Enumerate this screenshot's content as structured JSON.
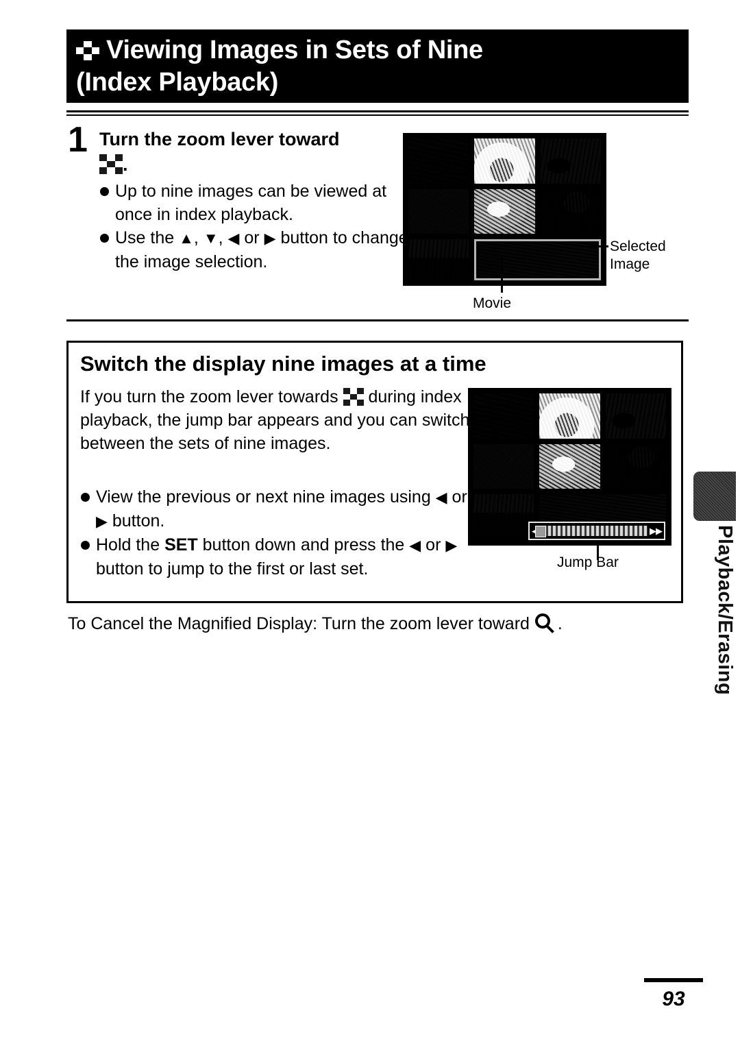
{
  "header": {
    "icon": "index-checkerboard-icon",
    "title_line1": "Viewing Images in Sets of Nine",
    "title_line2": "(Index Playback)"
  },
  "step1": {
    "number": "1",
    "heading_line1": "Turn the zoom lever toward",
    "heading_line2_icon": "index-checkerboard-icon",
    "heading_line2_suffix": ".",
    "bullets": [
      {
        "icon": "bullet-dot",
        "text": "Up to nine images can be viewed at once in index playback."
      },
      {
        "icon": "bullet-dot",
        "text_before": "Use the",
        "arrow_up": "▲",
        "sep1": ",",
        "arrow_down": "▼",
        "sep2": ",",
        "arrow_left": "◀",
        "or": "or",
        "arrow_right": "▶",
        "text_after": "button to change the image selection."
      }
    ],
    "screen": {
      "callout_selected": "Selected",
      "callout_selected_line2": "Image",
      "callout_movie": "Movie"
    }
  },
  "section": {
    "title": "Switch the display nine images at a time",
    "paragraph_part1": "If you turn the zoom lever towards",
    "paragraph_icon": "index-checkerboard-icon",
    "paragraph_part2": "during index playback, the jump bar appears and you can switch between the sets of nine images.",
    "bullets": [
      {
        "icon": "bullet-dot",
        "line1": "View the previous or next nine images",
        "line2_prefix": "using",
        "arrow_left": "◀",
        "or": "or",
        "arrow_right": "▶",
        "line2_suffix": "button."
      },
      {
        "icon": "bullet-dot",
        "line1_prefix": "Hold the",
        "set_label": "SET",
        "line1_suffix": "button down and press",
        "line2_prefix": "the",
        "arrow_left": "◀",
        "or": "or",
        "arrow_right": "▶",
        "line2_suffix": "button to jump to the first or last set."
      }
    ],
    "screen": {
      "jump_bar_left_arrow": "◀◀",
      "jump_bar_right_arrow": "▶▶",
      "callout_jump_bar": "Jump Bar"
    }
  },
  "cancel_note": {
    "text": "To Cancel the Magnified Display: Turn the zoom lever toward",
    "icon": "magnifier-icon",
    "suffix": "."
  },
  "side_tab": {
    "label": "Playback/Erasing"
  },
  "footer": {
    "page_number": "93"
  },
  "colors": {
    "banner_background": "#000000",
    "banner_text": "#ffffff",
    "body_text": "#000000",
    "page_background": "#ffffff",
    "screen_background": "#000000"
  }
}
